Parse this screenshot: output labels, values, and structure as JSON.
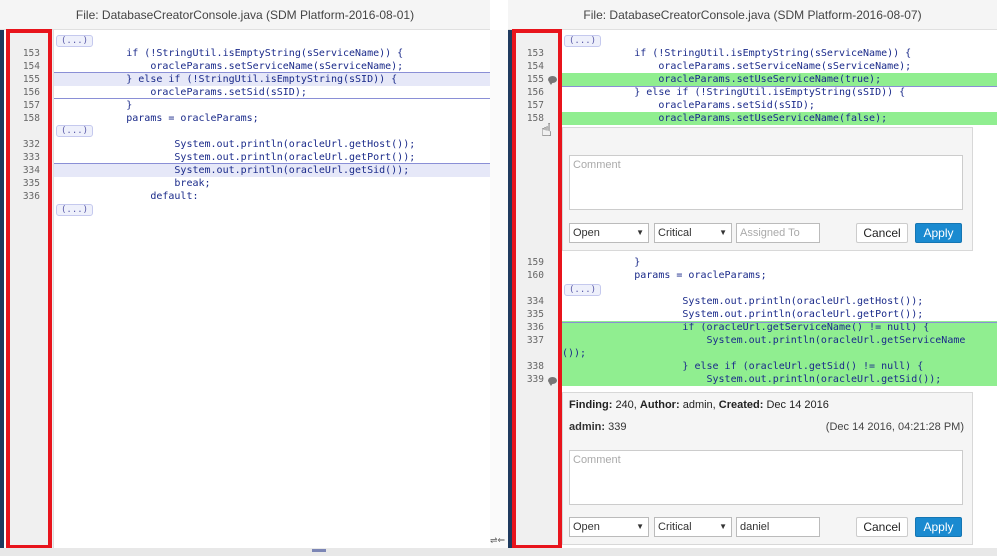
{
  "left_pane": {
    "header": "File: DatabaseCreatorConsole.java (SDM Platform-2016-08-01)",
    "collapse_label": "(...)",
    "lines": [
      {
        "num": "153",
        "text": "            if (!StringUtil.isEmptyString(sServiceName)) {"
      },
      {
        "num": "154",
        "text": "                oracleParams.setServiceName(sServiceName);"
      },
      {
        "num": "155",
        "text": "            } else if (!StringUtil.isEmptyString(sSID)) {"
      },
      {
        "num": "156",
        "text": "                oracleParams.setSid(sSID);"
      },
      {
        "num": "157",
        "text": "            }"
      },
      {
        "num": "158",
        "text": "            params = oracleParams;"
      },
      {
        "num": "332",
        "text": "                    System.out.println(oracleUrl.getHost());"
      },
      {
        "num": "333",
        "text": "                    System.out.println(oracleUrl.getPort());"
      },
      {
        "num": "334",
        "text": "                    System.out.println(oracleUrl.getSid());"
      },
      {
        "num": "335",
        "text": "                    break;"
      },
      {
        "num": "336",
        "text": "                default:"
      }
    ]
  },
  "right_pane": {
    "header": "File: DatabaseCreatorConsole.java (SDM Platform-2016-08-07)",
    "collapse_label": "(...)",
    "lines_top": [
      {
        "num": "153",
        "text": "            if (!StringUtil.isEmptyString(sServiceName)) {"
      },
      {
        "num": "154",
        "text": "                oracleParams.setServiceName(sServiceName);"
      },
      {
        "num": "155",
        "text": "                oracleParams.setUseServiceName(true);"
      },
      {
        "num": "156",
        "text": "            } else if (!StringUtil.isEmptyString(sSID)) {"
      },
      {
        "num": "157",
        "text": "                oracleParams.setSid(sSID);"
      },
      {
        "num": "158",
        "text": "                oracleParams.setUseServiceName(false);"
      }
    ],
    "lines_mid": [
      {
        "num": "159",
        "text": "            }"
      },
      {
        "num": "160",
        "text": "            params = oracleParams;"
      }
    ],
    "lines_bottom": [
      {
        "num": "334",
        "text": "                    System.out.println(oracleUrl.getHost());"
      },
      {
        "num": "335",
        "text": "                    System.out.println(oracleUrl.getPort());"
      },
      {
        "num": "336",
        "text": "                    if (oracleUrl.getServiceName() != null) {"
      },
      {
        "num": "337",
        "text": "                        System.out.println(oracleUrl.getServiceName"
      },
      {
        "num": "",
        "text": "());"
      },
      {
        "num": "338",
        "text": "                    } else if (oracleUrl.getSid() != null) {"
      },
      {
        "num": "339",
        "text": "                        System.out.println(oracleUrl.getSid());"
      }
    ]
  },
  "new_comment_form": {
    "comment_placeholder": "Comment",
    "status_value": "Open",
    "severity_value": "Critical",
    "assignee_placeholder": "Assigned To",
    "cancel_label": "Cancel",
    "apply_label": "Apply"
  },
  "finding_panel": {
    "finding_label": "Finding:",
    "finding_id": "240,",
    "author_label": "Author:",
    "author": "admin,",
    "created_label": "Created:",
    "created": "Dec 14 2016",
    "comment_user": "admin:",
    "comment_text": "339",
    "comment_time": "(Dec 14 2016, 04:21:28 PM)",
    "comment_placeholder": "Comment",
    "status_value": "Open",
    "severity_value": "Critical",
    "assignee_value": "daniel",
    "cancel_label": "Cancel",
    "apply_label": "Apply"
  },
  "center_icons": {
    "sync_arrows": "⇌⇐"
  },
  "colors": {
    "added_highlight": "#90ee90",
    "annotation_red": "#e8141c",
    "apply_blue": "#1a8ad0"
  }
}
